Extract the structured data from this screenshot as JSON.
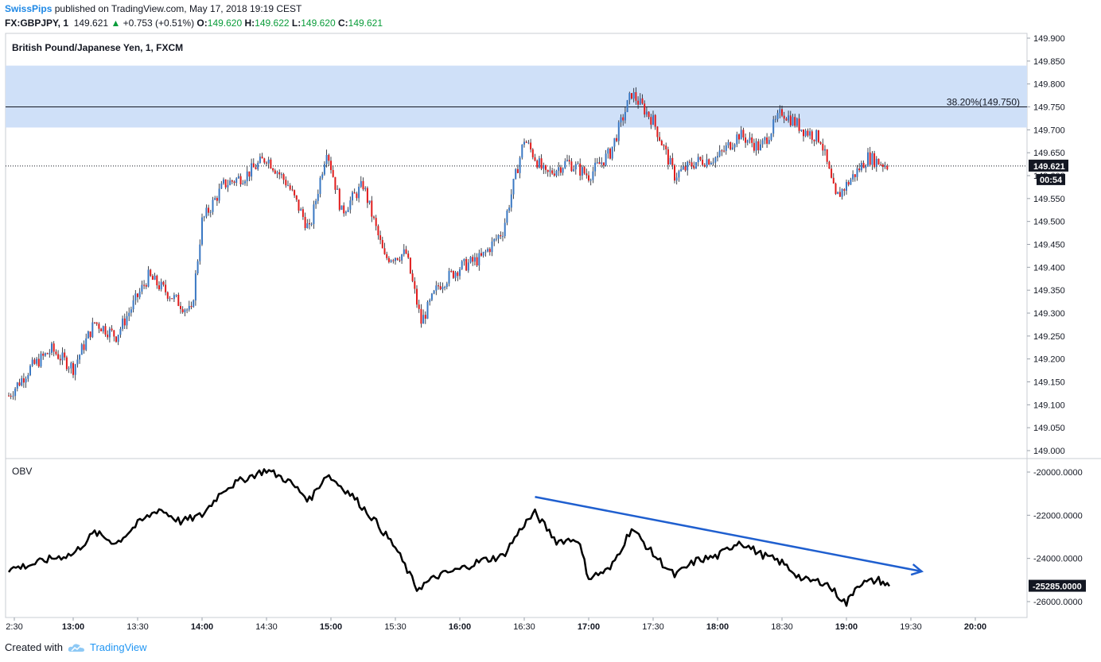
{
  "header": {
    "author": "SwissPips",
    "published_text": "published on TradingView.com, May 17, 2018 19:19 CEST",
    "symbol": "FX:GBPJPY, 1",
    "last": "149.621",
    "change": "+0.753 (+0.51%)",
    "open_label": "O:",
    "open": "149.620",
    "high_label": "H:",
    "high": "149.622",
    "low_label": "L:",
    "low": "149.620",
    "close_label": "C:",
    "close": "149.621"
  },
  "main_pane": {
    "title": "British Pound/Japanese Yen, 1, FXCM",
    "price_ticks": [
      "149.900",
      "149.850",
      "149.800",
      "149.750",
      "149.700",
      "149.650",
      "149.600",
      "149.550",
      "149.500",
      "149.450",
      "149.400",
      "149.350",
      "149.300",
      "149.250",
      "149.200",
      "149.150",
      "149.100",
      "149.050",
      "149.000"
    ],
    "fib_label": "38.20%(149.750)",
    "current_price": "149.621",
    "countdown": "00:54"
  },
  "obv_pane": {
    "title": "OBV",
    "ticks": [
      "-20000.0000",
      "-22000.0000",
      "-24000.0000",
      "-26000.0000"
    ],
    "current_value": "-25285.0000"
  },
  "time_axis": [
    "2:30",
    "13:00",
    "13:30",
    "14:00",
    "14:30",
    "15:00",
    "15:30",
    "16:00",
    "16:30",
    "17:00",
    "17:30",
    "18:00",
    "18:30",
    "19:00",
    "19:30",
    "20:00"
  ],
  "footer": {
    "created_with": "Created with",
    "brand": "TradingView"
  },
  "colors": {
    "up": "#3a78c3",
    "down": "#e01b1b",
    "zone": "#cfe0f8",
    "trend": "#1f5fcf"
  },
  "chart_data": {
    "type": "candlestick",
    "price_range": [
      149.0,
      149.9
    ],
    "resistance_zone": [
      149.705,
      149.84
    ],
    "fib_level": 149.75,
    "current_price": 149.621,
    "price_path": [
      [
        "12:30",
        149.12
      ],
      [
        "12:40",
        149.18
      ],
      [
        "12:50",
        149.22
      ],
      [
        "13:00",
        149.18
      ],
      [
        "13:10",
        149.28
      ],
      [
        "13:20",
        149.25
      ],
      [
        "13:35",
        149.38
      ],
      [
        "13:45",
        149.34
      ],
      [
        "13:55",
        149.3
      ],
      [
        "14:00",
        149.5
      ],
      [
        "14:10",
        149.58
      ],
      [
        "14:20",
        149.6
      ],
      [
        "14:30",
        149.64
      ],
      [
        "14:40",
        149.58
      ],
      [
        "14:50",
        149.48
      ],
      [
        "14:58",
        149.66
      ],
      [
        "15:05",
        149.52
      ],
      [
        "15:15",
        149.58
      ],
      [
        "15:25",
        149.42
      ],
      [
        "15:35",
        149.43
      ],
      [
        "15:42",
        149.28
      ],
      [
        "15:50",
        149.36
      ],
      [
        "16:00",
        149.4
      ],
      [
        "16:10",
        149.42
      ],
      [
        "16:20",
        149.48
      ],
      [
        "16:30",
        149.68
      ],
      [
        "16:40",
        149.6
      ],
      [
        "16:50",
        149.63
      ],
      [
        "17:00",
        149.6
      ],
      [
        "17:10",
        149.65
      ],
      [
        "17:20",
        149.78
      ],
      [
        "17:30",
        149.72
      ],
      [
        "17:40",
        149.6
      ],
      [
        "17:50",
        149.63
      ],
      [
        "18:00",
        149.64
      ],
      [
        "18:10",
        149.69
      ],
      [
        "18:20",
        149.66
      ],
      [
        "18:30",
        149.74
      ],
      [
        "18:40",
        149.7
      ],
      [
        "18:48",
        149.68
      ],
      [
        "18:55",
        149.55
      ],
      [
        "19:00",
        149.58
      ],
      [
        "19:10",
        149.64
      ],
      [
        "19:20",
        149.62
      ]
    ],
    "obv_range": [
      -26500,
      -19500
    ],
    "obv_path": [
      [
        "12:30",
        -24500
      ],
      [
        "12:40",
        -24300
      ],
      [
        "12:50",
        -24000
      ],
      [
        "13:00",
        -23800
      ],
      [
        "13:10",
        -22800
      ],
      [
        "13:20",
        -23300
      ],
      [
        "13:30",
        -22400
      ],
      [
        "13:40",
        -21700
      ],
      [
        "13:50",
        -22300
      ],
      [
        "14:00",
        -22000
      ],
      [
        "14:10",
        -20800
      ],
      [
        "14:20",
        -20300
      ],
      [
        "14:30",
        -19900
      ],
      [
        "14:40",
        -20400
      ],
      [
        "14:50",
        -21300
      ],
      [
        "14:58",
        -20100
      ],
      [
        "15:10",
        -21100
      ],
      [
        "15:20",
        -22200
      ],
      [
        "15:30",
        -23500
      ],
      [
        "15:40",
        -25400
      ],
      [
        "15:50",
        -24800
      ],
      [
        "16:00",
        -24500
      ],
      [
        "16:10",
        -24100
      ],
      [
        "16:20",
        -23900
      ],
      [
        "16:30",
        -22400
      ],
      [
        "16:35",
        -21900
      ],
      [
        "16:45",
        -23200
      ],
      [
        "16:55",
        -23100
      ],
      [
        "17:00",
        -24900
      ],
      [
        "17:10",
        -24500
      ],
      [
        "17:20",
        -22600
      ],
      [
        "17:30",
        -23800
      ],
      [
        "17:40",
        -24800
      ],
      [
        "17:50",
        -24100
      ],
      [
        "18:00",
        -23900
      ],
      [
        "18:10",
        -23200
      ],
      [
        "18:20",
        -23800
      ],
      [
        "18:30",
        -24200
      ],
      [
        "18:40",
        -25000
      ],
      [
        "18:50",
        -25100
      ],
      [
        "19:00",
        -26100
      ],
      [
        "19:05",
        -25200
      ],
      [
        "19:15",
        -25000
      ],
      [
        "19:20",
        -25285
      ]
    ],
    "obv_trendline": [
      [
        "16:35",
        -21150
      ],
      [
        "19:35",
        -24600
      ]
    ]
  }
}
